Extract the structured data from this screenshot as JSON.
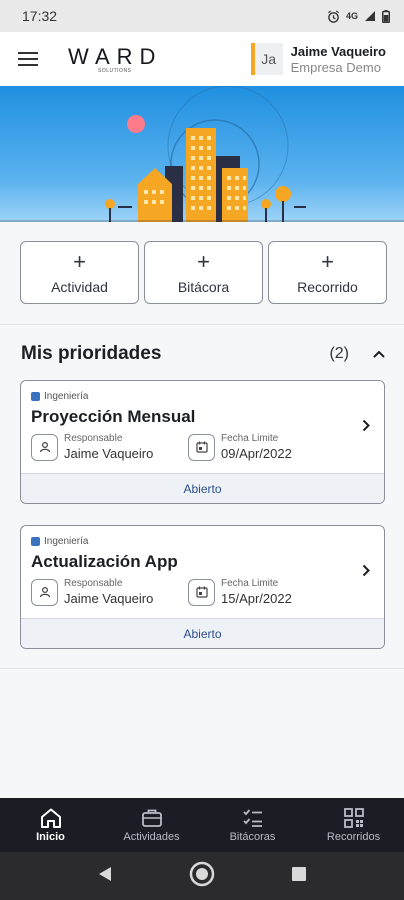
{
  "status_bar": {
    "time": "17:32",
    "network": "4G"
  },
  "header": {
    "logo_text": "WARD",
    "logo_sub": "SOLUTIONS",
    "user": {
      "initials": "Ja",
      "name": "Jaime Vaqueiro",
      "company": "Empresa Demo"
    }
  },
  "actions": [
    {
      "label": "Actividad"
    },
    {
      "label": "Bitácora"
    },
    {
      "label": "Recorrido"
    }
  ],
  "priorities": {
    "title": "Mis prioridades",
    "count": "(2)",
    "items": [
      {
        "category": "Ingeniería",
        "title": "Proyección Mensual",
        "responsable_label": "Responsable",
        "responsable": "Jaime Vaqueiro",
        "fecha_label": "Fecha Limite",
        "fecha": "09/Apr/2022",
        "status": "Abierto"
      },
      {
        "category": "Ingeniería",
        "title": "Actualización App",
        "responsable_label": "Responsable",
        "responsable": "Jaime Vaqueiro",
        "fecha_label": "Fecha Limite",
        "fecha": "15/Apr/2022",
        "status": "Abierto"
      }
    ]
  },
  "bottom_nav": [
    {
      "label": "Inicio",
      "icon": "home-icon",
      "active": true
    },
    {
      "label": "Actividades",
      "icon": "briefcase-icon"
    },
    {
      "label": "Bitácoras",
      "icon": "checklist-icon"
    },
    {
      "label": "Recorridos",
      "icon": "qr-code-icon"
    }
  ],
  "colors": {
    "accent": "#f5a623",
    "tag": "#3a72c0",
    "status_text": "#2d4f8a",
    "nav_bg": "#1c1d24",
    "hero_sky": "#1f8fe0"
  }
}
